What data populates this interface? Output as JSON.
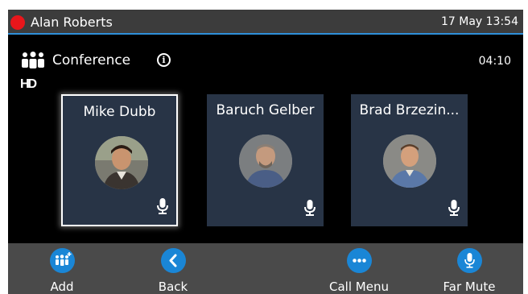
{
  "header": {
    "user_name": "Alan Roberts",
    "datetime": "17 May 13:54",
    "presence_color": "#e8161b",
    "accent_color": "#2e8fd9"
  },
  "call": {
    "label": "Conference",
    "timer": "04:10",
    "hd_badge": "HD"
  },
  "participants": [
    {
      "name": "Mike Dubb",
      "selected": true
    },
    {
      "name": "Baruch Gelber",
      "selected": false
    },
    {
      "name": "Brad Brzezin...",
      "selected": false
    }
  ],
  "softkeys": [
    {
      "label": "Add",
      "icon": "add-participant-icon"
    },
    {
      "label": "Back",
      "icon": "chevron-left-icon"
    },
    {
      "label": "Call Menu",
      "icon": "ellipsis-icon"
    },
    {
      "label": "Far Mute",
      "icon": "microphone-icon"
    }
  ],
  "colors": {
    "tile_background": "#283446",
    "softkey_icon": "#1a86d6",
    "softkey_bar": "#4a4a4a"
  }
}
